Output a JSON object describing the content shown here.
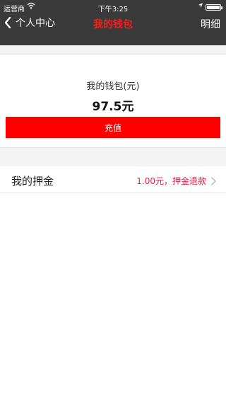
{
  "status_bar": {
    "carrier": "运营商",
    "time": "下午3:25",
    "icons": [
      "wifi-icon",
      "location-icon",
      "battery-icon"
    ]
  },
  "nav": {
    "back_label": "个人中心",
    "title": "我的钱包",
    "right_label": "明细",
    "title_color": "#ff1a1a",
    "bar_color": "#3a3a3a"
  },
  "wallet": {
    "label": "我的钱包(元)",
    "amount": "97.5元",
    "recharge_label": "充值",
    "button_color": "#ff0000"
  },
  "deposit": {
    "label": "我的押金",
    "value": "1.00元，押金退款",
    "value_color": "#e8234b"
  }
}
